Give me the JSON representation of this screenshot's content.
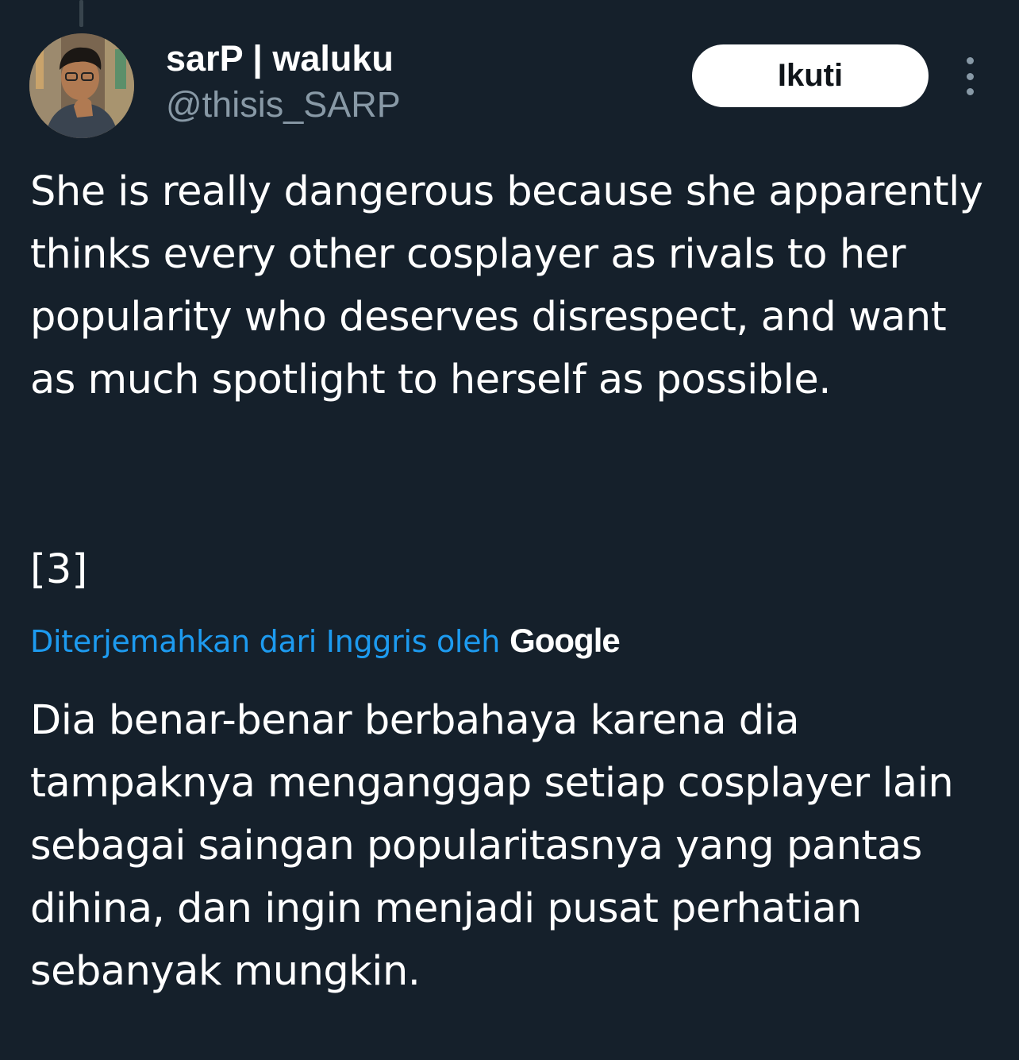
{
  "tweet": {
    "author": {
      "display_name": "sarP | waluku",
      "handle": "@thisis_SARP",
      "avatar_icon": "profile-photo"
    },
    "follow_label": "Ikuti",
    "more_icon": "vertical-ellipsis-icon",
    "text": "She is really dangerous because she apparently thinks every other cosplayer as rivals to her popularity who deserves disrespect, and want as much spotlight to herself as possible.",
    "ref": "[3]",
    "translation": {
      "label": "Diterjemahkan dari Inggris oleh",
      "provider": "Google",
      "text": "Dia benar-benar berbahaya karena dia tampaknya menganggap setiap cosplayer lain sebagai saingan popularitasnya yang pantas dihina, dan ingin menjadi pusat perhatian sebanyak mungkin."
    }
  },
  "colors": {
    "background": "#15202b",
    "primary_text": "#ffffff",
    "secondary_text": "#8899a6",
    "link": "#1d9bf0",
    "follow_bg": "#ffffff"
  }
}
